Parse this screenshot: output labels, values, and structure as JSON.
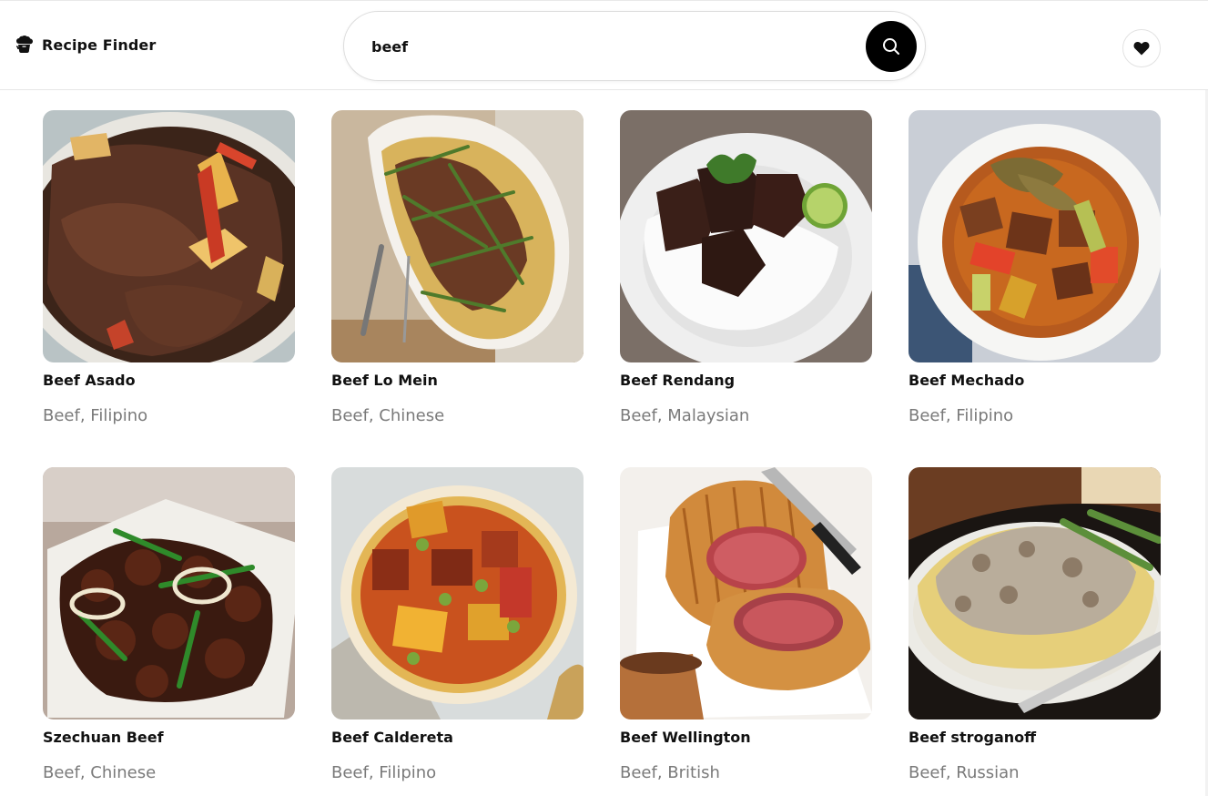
{
  "header": {
    "app_title": "Recipe Finder",
    "brand_icon": "chef-hat-icon",
    "search": {
      "value": "beef",
      "placeholder": "",
      "button_icon": "search-icon"
    },
    "favorites_icon": "heart-icon"
  },
  "colors": {
    "accent": "#000000",
    "meta_text": "#7a7a7a"
  },
  "recipes": [
    {
      "title": "Beef Asado",
      "meta": "Beef, Filipino"
    },
    {
      "title": "Beef Lo Mein",
      "meta": "Beef, Chinese"
    },
    {
      "title": "Beef Rendang",
      "meta": "Beef, Malaysian"
    },
    {
      "title": "Beef Mechado",
      "meta": "Beef, Filipino"
    },
    {
      "title": "Szechuan Beef",
      "meta": "Beef, Chinese"
    },
    {
      "title": "Beef Caldereta",
      "meta": "Beef, Filipino"
    },
    {
      "title": "Beef Wellington",
      "meta": "Beef, British"
    },
    {
      "title": "Beef stroganoff",
      "meta": "Beef, Russian"
    }
  ]
}
